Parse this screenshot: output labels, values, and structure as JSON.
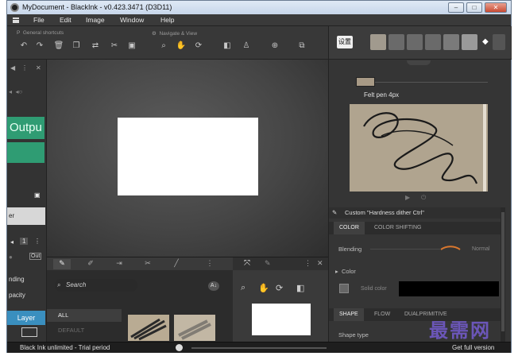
{
  "window": {
    "title": "MyDocument - BlackInk - v0.423.3471 (D3D11)",
    "buttons": {
      "minimize": "–",
      "maximize": "□",
      "close": "✕"
    }
  },
  "menu": {
    "items": [
      "File",
      "Edit",
      "Image",
      "Window",
      "Help"
    ]
  },
  "toolbar": {
    "group1_label": "General shortcuts",
    "group2_label": "Navigate & View"
  },
  "left_panel": {
    "header_left": "◀",
    "header_right": "✕",
    "output_label": "Outpu",
    "white_row_text": "er",
    "tab_label": "1",
    "value_box": "Out",
    "blending_text": "nding",
    "opacity_text": "pacity",
    "layer_button": "Layer"
  },
  "brush_panel": {
    "search_placeholder": "Search",
    "ak_badge": "A↓",
    "categories": [
      {
        "label": "ALL",
        "active": true
      },
      {
        "label": "DEFAULT",
        "active": false
      }
    ]
  },
  "right_panel": {
    "settings_button": "设置",
    "brush_name": "Felt pen 4px",
    "custom_label": "Custom \"Hardness dither Ctrl\"",
    "tabs_top": [
      "COLOR",
      "COLOR SHIFTING"
    ],
    "blending_label": "Blending",
    "blending_value": "Normal",
    "color_label": "Color",
    "solid_color_label": "Solid color",
    "tabs_bottom": [
      "SHAPE",
      "FLOW",
      "DUALPRIMITIVE"
    ],
    "shape_type_label": "Shape type",
    "colors": {
      "preview_bg": "#b0a48f",
      "accent_green": "#2f9c73",
      "accent_blue": "#3a8fbf"
    }
  },
  "status": {
    "left_text": "Black Ink unlimited - Trial period",
    "right_text": "Get full version"
  },
  "watermark": "最需网"
}
